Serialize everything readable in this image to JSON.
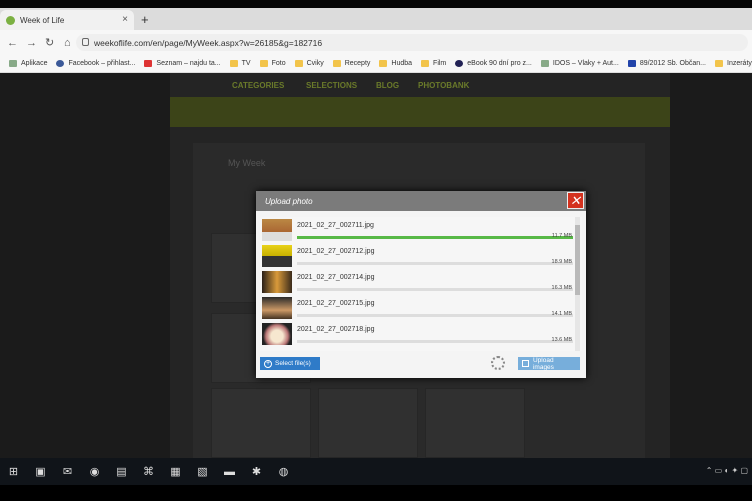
{
  "browser": {
    "tab_title": "Week of Life",
    "tab_close": "×",
    "new_tab": "+",
    "url": "weekoflife.com/en/page/MyWeek.aspx?w=26185&g=182716",
    "bookmarks": [
      "Aplikace",
      "Facebook – přihlast...",
      "Seznam – najdu ta...",
      "TV",
      "Foto",
      "Cviky",
      "Recepty",
      "Hudba",
      "Film",
      "eBook 90 dní pro z...",
      "IDOS – Vlaky + Aut...",
      "89/2012 Sb. Občan...",
      "Inzeráty"
    ]
  },
  "modal": {
    "title": "Upload photo",
    "close": "✕",
    "files": [
      {
        "name": "2021_02_27_002711.jpg",
        "size": "11.7 MB",
        "progress": 1.0
      },
      {
        "name": "2021_02_27_002712.jpg",
        "size": "18.9 MB",
        "progress": 0
      },
      {
        "name": "2021_02_27_002714.jpg",
        "size": "16.3 MB",
        "progress": 0
      },
      {
        "name": "2021_02_27_002715.jpg",
        "size": "14.1 MB",
        "progress": 0
      },
      {
        "name": "2021_02_27_002718.jpg",
        "size": "13.6 MB",
        "progress": 0
      }
    ],
    "select_label": "Select file(s)",
    "upload_label": "Upload images"
  },
  "background": {
    "nav": [
      "CATEGORIES",
      "SELECTIONS",
      "BLOG",
      "PHOTOBANK"
    ],
    "page_title": "My Week"
  },
  "colors": {
    "accent": "#58b947",
    "close": "#d4321f",
    "button": "#2f7bc8"
  }
}
